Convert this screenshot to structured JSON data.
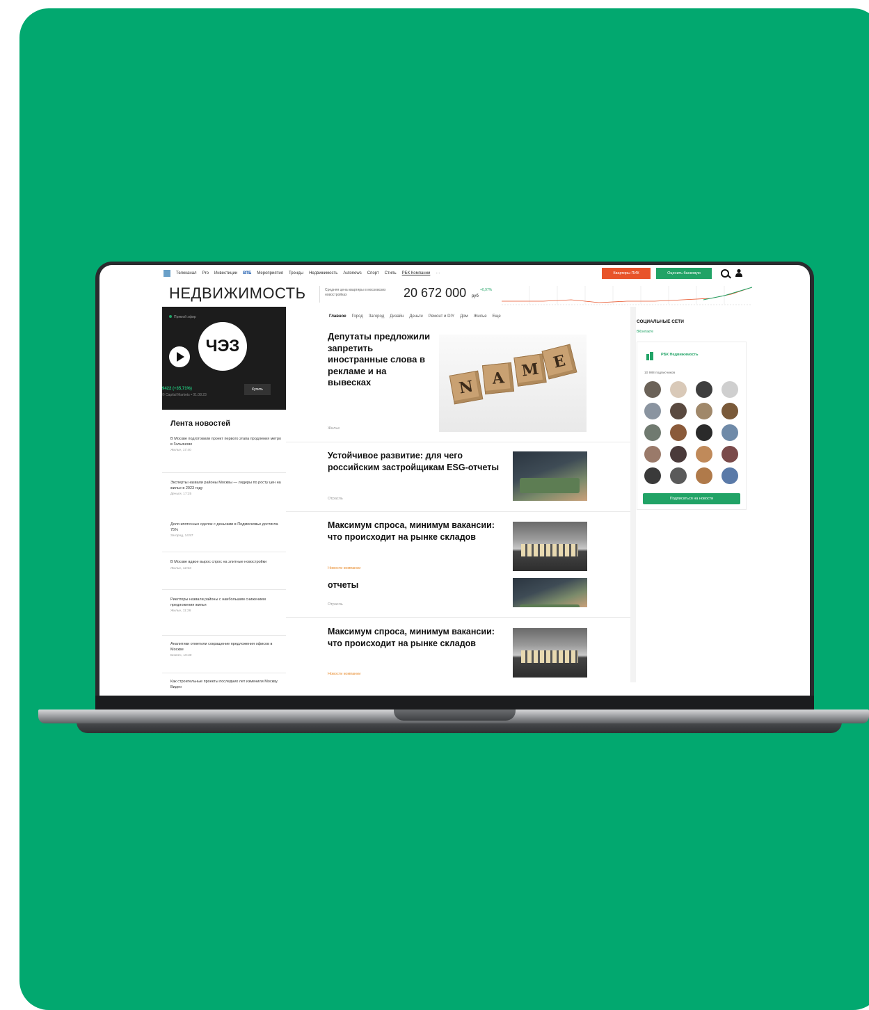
{
  "nav": {
    "items": [
      "Телеканал",
      "Pro",
      "Инвестиции",
      "ВТБ",
      "Мероприятия",
      "Тренды",
      "Недвижимость",
      "Autonews",
      "Спорт",
      "Стиль",
      "РБК Компании",
      "···"
    ],
    "btn_orange": "Квартиры ПИК",
    "btn_green": "Оценить банковую"
  },
  "brand": "НЕДВИЖИМОСТЬ",
  "price_widget": {
    "caption": "Средняя цена квартиры в московских новостройках",
    "value": "20 672 000",
    "unit": "руб",
    "change": "+0,97%"
  },
  "promo": {
    "tag": "Прямой эфир",
    "logo_text": "ЧЭЗ",
    "ticker": "9422 (+35,71%)",
    "ticker_sub": "© Capital Markets • 01.08.23",
    "buy_label": "Купить"
  },
  "feed": {
    "title": "Лента новостей",
    "items": [
      {
        "text": "В Москве подготовили проект первого этапа продления метро в Гальяново",
        "meta": "Жилье, 17:40"
      },
      {
        "text": "Эксперты назвали районы Москвы — лидеры по росту цен на жилье в 2023 году",
        "meta": "Деньги, 17:25"
      },
      {
        "text": "Доля ипотечных сделок с деньгами в Подмосковье достигла 75%",
        "meta": "Загород, 14:57"
      },
      {
        "text": "В Москве вдвое вырос спрос на элитные новостройки",
        "meta": "Жилье, 12:53"
      },
      {
        "text": "Риелторы назвали районы с наибольшим снижением предложения жилья",
        "meta": "Жилье, 11:26"
      },
      {
        "text": "Аналитики отметили сокращение предложения офисов в Москве",
        "meta": "Бизнес, 10:30"
      },
      {
        "text": "Как строительные проекты последних лет изменили Москву. Видео",
        "meta": ""
      }
    ]
  },
  "tabs": [
    "Главное",
    "Город",
    "Загород",
    "Дизайн",
    "Деньги",
    "Ремонт и DIY",
    "Дом",
    "Жилье",
    "Еще"
  ],
  "articles": [
    {
      "headline": "Депутаты предложили запретить иностранные слова в рекламе и на вывесках",
      "rubric": "Жилье",
      "image_letters": [
        "N",
        "A",
        "M",
        "E"
      ]
    },
    {
      "headline": "Устойчивое развитие: для чего российским застройщикам ESG-отчеты",
      "rubric": "Отрасль"
    },
    {
      "headline": "Максимум спроса, минимум вакансии: что происходит на рынке складов",
      "rubric": "Новости компании"
    },
    {
      "headline": "отчеты",
      "rubric": "Отрасль"
    },
    {
      "headline": "Максимум спроса, минимум вакансии: что происходит на рынке складов",
      "rubric": "Новости компании"
    }
  ],
  "social": {
    "title": "СОЦИАЛЬНЫЕ СЕТИ",
    "sub": "ВКонтакте",
    "group": "РБК Недвижимость",
    "count": "10 988 подписчиков",
    "subscribe": "Подписаться на новости"
  },
  "colors": {
    "background": "#02A86F",
    "accent_green": "#21a366",
    "accent_orange": "#e8542a"
  }
}
